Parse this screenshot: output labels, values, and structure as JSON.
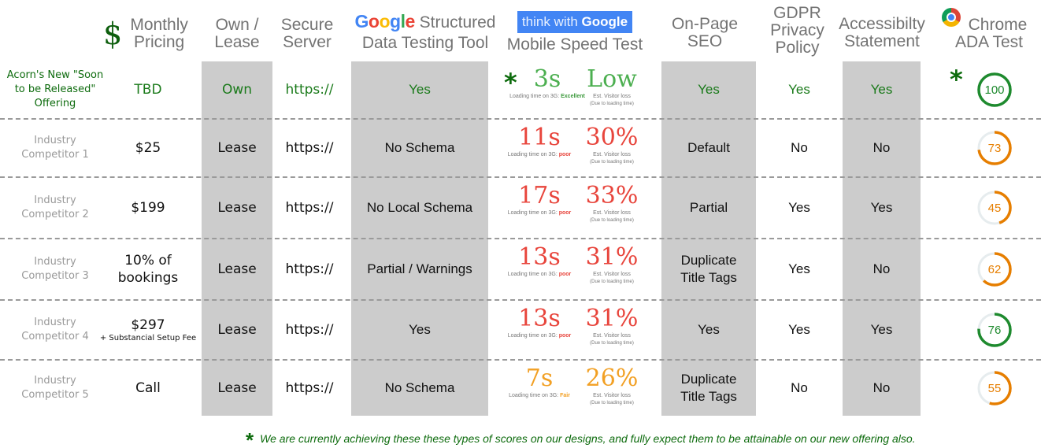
{
  "headers": {
    "dollar_icon": "$",
    "monthly_pricing": [
      "Monthly",
      "Pricing"
    ],
    "own_lease": [
      "Own /",
      "Lease"
    ],
    "secure_server": [
      "Secure",
      "Server"
    ],
    "structured_data": {
      "google_logo": "Google",
      "line1": "Structured",
      "line2": "Data Testing Tool"
    },
    "mobile_speed": {
      "badge_prefix": "think with",
      "badge_brand": "Google",
      "line2": "Mobile Speed Test"
    },
    "on_page_seo": [
      "On-Page",
      "SEO"
    ],
    "gdpr": [
      "GDPR",
      "Privacy",
      "Policy"
    ],
    "accessibility": [
      "Accessibilty",
      "Statement"
    ],
    "chrome_ada": [
      "Chrome",
      "ADA Test"
    ]
  },
  "colors": {
    "green": "#1a7a1a",
    "dark_green": "#0d6b0d",
    "poor_red": "#e8453c",
    "fair_orange": "#f2a024",
    "excellent_green": "#4caf50",
    "gauge_orange": "#e67e00",
    "gauge_green": "#1e8a2e",
    "gauge_track": "#e6ecee",
    "column_gray": "#cccccc",
    "google_blue": "#4285f4"
  },
  "speed_labels": {
    "loading_prefix": "Loading time on 3G:",
    "loss_line1": "Est. Visitor loss",
    "loss_line2": "(Due to loading time)"
  },
  "rows": [
    {
      "name": [
        "Acorn's New \"Soon",
        "to be Released\"",
        "Offering"
      ],
      "highlight": true,
      "price": "TBD",
      "price_note": "",
      "own_lease": "Own",
      "secure_server": "https://",
      "structured_data": "Yes",
      "speed": {
        "time": "3s",
        "rating": "Excellent",
        "loss": "Low",
        "level": "good",
        "starred": true
      },
      "on_page_seo": "Yes",
      "gdpr": "Yes",
      "accessibility": "Yes",
      "ada_score": 100,
      "ada_starred": true
    },
    {
      "name": [
        "Industry",
        "Competitor 1"
      ],
      "highlight": false,
      "price": "$25",
      "price_note": "",
      "own_lease": "Lease",
      "secure_server": "https://",
      "structured_data": "No Schema",
      "speed": {
        "time": "11s",
        "rating": "poor",
        "loss": "30%",
        "level": "poor",
        "starred": false
      },
      "on_page_seo": "Default",
      "gdpr": "No",
      "accessibility": "No",
      "ada_score": 73,
      "ada_starred": false
    },
    {
      "name": [
        "Industry",
        "Competitor 2"
      ],
      "highlight": false,
      "price": "$199",
      "price_note": "",
      "own_lease": "Lease",
      "secure_server": "https://",
      "structured_data": "No Local Schema",
      "speed": {
        "time": "17s",
        "rating": "poor",
        "loss": "33%",
        "level": "poor",
        "starred": false
      },
      "on_page_seo": "Partial",
      "gdpr": "Yes",
      "accessibility": "Yes",
      "ada_score": 45,
      "ada_starred": false
    },
    {
      "name": [
        "Industry",
        "Competitor 3"
      ],
      "highlight": false,
      "price": "10% of bookings",
      "price_note": "",
      "own_lease": "Lease",
      "secure_server": "https://",
      "structured_data": "Partial / Warnings",
      "speed": {
        "time": "13s",
        "rating": "poor",
        "loss": "31%",
        "level": "poor",
        "starred": false
      },
      "on_page_seo": "Duplicate Title Tags",
      "gdpr": "Yes",
      "accessibility": "No",
      "ada_score": 62,
      "ada_starred": false
    },
    {
      "name": [
        "Industry",
        "Competitor 4"
      ],
      "highlight": false,
      "price": "$297",
      "price_note": "+ Substancial Setup Fee",
      "own_lease": "Lease",
      "secure_server": "https://",
      "structured_data": "Yes",
      "speed": {
        "time": "13s",
        "rating": "poor",
        "loss": "31%",
        "level": "poor",
        "starred": false
      },
      "on_page_seo": "Yes",
      "gdpr": "Yes",
      "accessibility": "Yes",
      "ada_score": 76,
      "ada_starred": false
    },
    {
      "name": [
        "Industry",
        "Competitor 5"
      ],
      "highlight": false,
      "price": "Call",
      "price_note": "",
      "own_lease": "Lease",
      "secure_server": "https://",
      "structured_data": "No Schema",
      "speed": {
        "time": "7s",
        "rating": "Fair",
        "loss": "26%",
        "level": "fair",
        "starred": false
      },
      "on_page_seo": "Duplicate Title Tags",
      "gdpr": "No",
      "accessibility": "No",
      "ada_score": 55,
      "ada_starred": false
    }
  ],
  "footnote": {
    "star": "*",
    "text": "We are currently achieving these these types of scores on our designs, and fully expect them to be attainable on our new offering also."
  }
}
